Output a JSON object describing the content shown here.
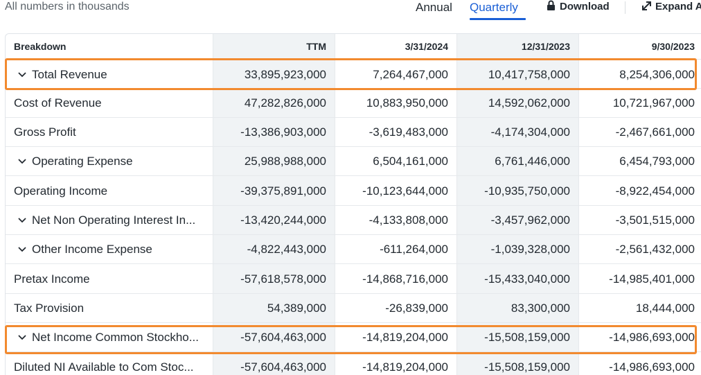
{
  "toolbar": {
    "note": "All numbers in thousands",
    "tabs": [
      {
        "label": "Annual"
      },
      {
        "label": "Quarterly"
      }
    ],
    "active_tab": "Quarterly",
    "download_label": "Download",
    "download_icon": "lock-icon",
    "expand_label": "Expand A",
    "expand_icon": "expand-arrows-icon"
  },
  "colors": {
    "accent": "#1a5fd6",
    "highlight": "#f28a2f",
    "shaded_column": "#f0f3f5"
  },
  "table": {
    "columns": [
      "Breakdown",
      "TTM",
      "3/31/2024",
      "12/31/2023",
      "9/30/2023"
    ],
    "rows": [
      {
        "label": "Total Revenue",
        "expandable": true,
        "highlighted": true,
        "values": [
          "33,895,923,000",
          "7,264,467,000",
          "10,417,758,000",
          "8,254,306,000"
        ]
      },
      {
        "label": "Cost of Revenue",
        "expandable": false,
        "highlighted": false,
        "values": [
          "47,282,826,000",
          "10,883,950,000",
          "14,592,062,000",
          "10,721,967,000"
        ]
      },
      {
        "label": "Gross Profit",
        "expandable": false,
        "highlighted": false,
        "values": [
          "-13,386,903,000",
          "-3,619,483,000",
          "-4,174,304,000",
          "-2,467,661,000"
        ]
      },
      {
        "label": "Operating Expense",
        "expandable": true,
        "highlighted": false,
        "values": [
          "25,988,988,000",
          "6,504,161,000",
          "6,761,446,000",
          "6,454,793,000"
        ]
      },
      {
        "label": "Operating Income",
        "expandable": false,
        "highlighted": false,
        "values": [
          "-39,375,891,000",
          "-10,123,644,000",
          "-10,935,750,000",
          "-8,922,454,000"
        ]
      },
      {
        "label": "Net Non Operating Interest In...",
        "expandable": true,
        "highlighted": false,
        "values": [
          "-13,420,244,000",
          "-4,133,808,000",
          "-3,457,962,000",
          "-3,501,515,000"
        ]
      },
      {
        "label": "Other Income Expense",
        "expandable": true,
        "highlighted": false,
        "values": [
          "-4,822,443,000",
          "-611,264,000",
          "-1,039,328,000",
          "-2,561,432,000"
        ]
      },
      {
        "label": "Pretax Income",
        "expandable": false,
        "highlighted": false,
        "values": [
          "-57,618,578,000",
          "-14,868,716,000",
          "-15,433,040,000",
          "-14,985,401,000"
        ]
      },
      {
        "label": "Tax Provision",
        "expandable": false,
        "highlighted": false,
        "values": [
          "54,389,000",
          "-26,839,000",
          "83,300,000",
          "18,444,000"
        ]
      },
      {
        "label": "Net Income Common Stockho...",
        "expandable": true,
        "highlighted": true,
        "values": [
          "-57,604,463,000",
          "-14,819,204,000",
          "-15,508,159,000",
          "-14,986,693,000"
        ]
      },
      {
        "label": "Diluted NI Available to Com Stoc...",
        "expandable": false,
        "highlighted": false,
        "values": [
          "-57,604,463,000",
          "-14,819,204,000",
          "-15,508,159,000",
          "-14,986,693,000"
        ]
      }
    ]
  }
}
